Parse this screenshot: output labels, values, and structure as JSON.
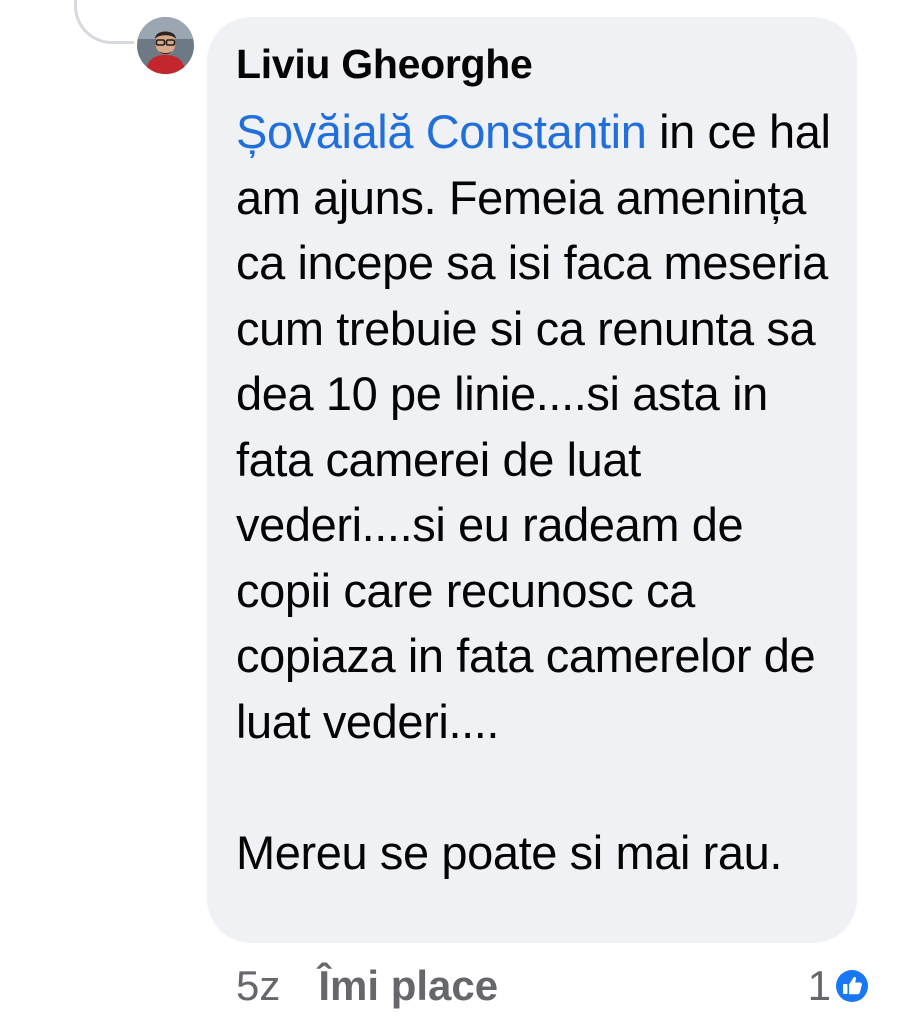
{
  "comment": {
    "author": "Liviu Gheorghe",
    "mention": "Șovăială Constantin",
    "text": " in ce hal am ajuns. Femeia amenința ca incepe sa isi faca meseria cum trebuie si ca renunta sa dea 10 pe linie....si asta in fata camerei de luat vederi....si eu radeam de copii care recunosc ca copiaza in fata camerelor de luat vederi....\n\nMereu se poate si mai rau.",
    "timestamp": "5z",
    "like_label": "Îmi place",
    "reaction_count": "1",
    "reaction_icon": "like-icon",
    "colors": {
      "bubble": "#eff1f4",
      "mention": "#216fdb",
      "meta": "#65676b",
      "like_badge": "#1877f2"
    }
  }
}
